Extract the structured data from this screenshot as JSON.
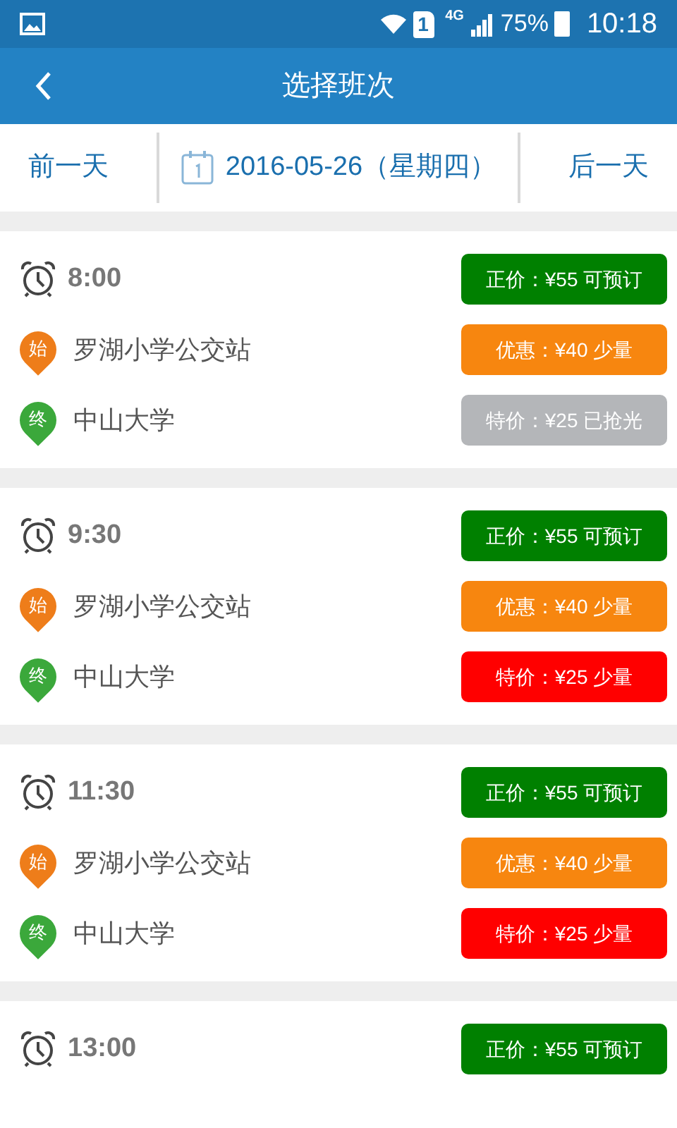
{
  "status_bar": {
    "sim": "1",
    "network": "4G",
    "battery": "75%",
    "time": "10:18"
  },
  "app_bar": {
    "title": "选择班次"
  },
  "date_bar": {
    "prev": "前一天",
    "date": "2016-05-26（星期四）",
    "next": "后一天"
  },
  "schedules": [
    {
      "time": "8:00",
      "stops": [
        {
          "kind": "start",
          "marker": "始",
          "name": "罗湖小学公交站"
        },
        {
          "kind": "end",
          "marker": "终",
          "name": "中山大学"
        }
      ],
      "tickets": [
        {
          "label": "正价：¥55 可预订",
          "color": "#008000"
        },
        {
          "label": "优惠：¥40 少量",
          "color": "#f7860f"
        },
        {
          "label": "特价：¥25 已抢光",
          "color": "#b4b6b9"
        }
      ]
    },
    {
      "time": "9:30",
      "stops": [
        {
          "kind": "start",
          "marker": "始",
          "name": "罗湖小学公交站"
        },
        {
          "kind": "end",
          "marker": "终",
          "name": "中山大学"
        }
      ],
      "tickets": [
        {
          "label": "正价：¥55 可预订",
          "color": "#008000"
        },
        {
          "label": "优惠：¥40 少量",
          "color": "#f7860f"
        },
        {
          "label": "特价：¥25 少量",
          "color": "#ff0000"
        }
      ]
    },
    {
      "time": "11:30",
      "stops": [
        {
          "kind": "start",
          "marker": "始",
          "name": "罗湖小学公交站"
        },
        {
          "kind": "end",
          "marker": "终",
          "name": "中山大学"
        }
      ],
      "tickets": [
        {
          "label": "正价：¥55 可预订",
          "color": "#008000"
        },
        {
          "label": "优惠：¥40 少量",
          "color": "#f7860f"
        },
        {
          "label": "特价：¥25 少量",
          "color": "#ff0000"
        }
      ]
    },
    {
      "time": "13:00",
      "tickets": [
        {
          "label": "正价：¥55 可预订",
          "color": "#008000"
        }
      ]
    }
  ]
}
